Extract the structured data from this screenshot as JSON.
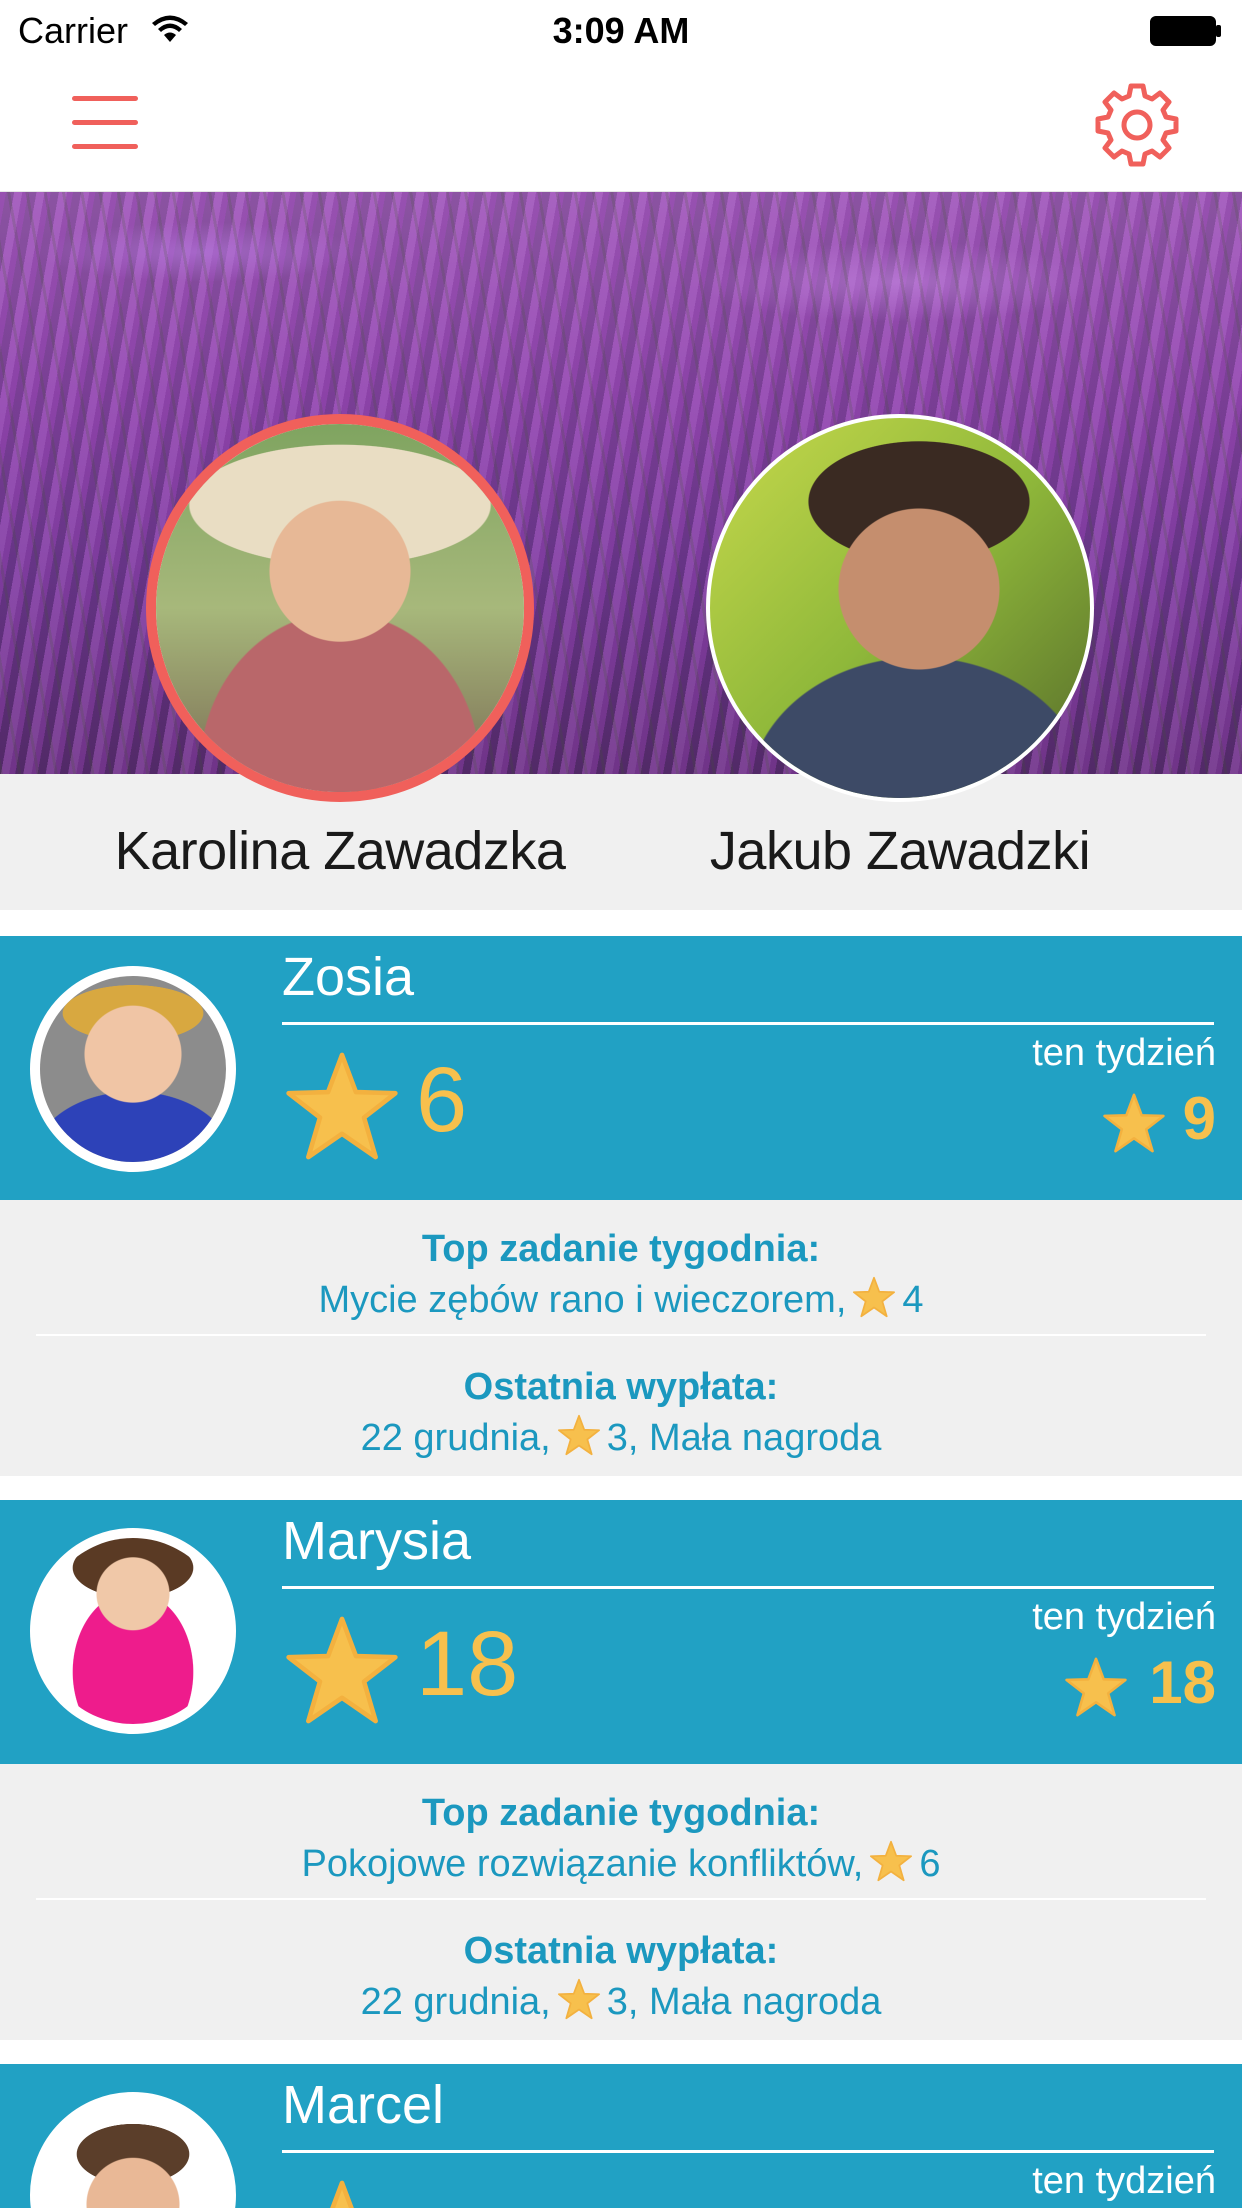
{
  "status_bar": {
    "carrier": "Carrier",
    "time": "3:09 AM"
  },
  "nav": {
    "menu_icon": "hamburger-menu-icon",
    "settings_icon": "gear-icon",
    "accent_color": "#f0605b"
  },
  "parents": [
    {
      "name": "Karolina Zawadzka",
      "selected": true
    },
    {
      "name": "Jakub Zawadzki",
      "selected": false
    }
  ],
  "children": [
    {
      "name": "Zosia",
      "stars": "6",
      "week_label": "ten tydzień",
      "week_stars": "9",
      "top_task_title": "Top zadanie tygodnia:",
      "top_task_text": "Mycie zębów rano i wieczorem,",
      "top_task_stars": "4",
      "payout_title": "Ostatnia wypłata:",
      "payout_date": "22 grudnia,",
      "payout_stars": "3, Mała nagroda"
    },
    {
      "name": "Marysia",
      "stars": "18",
      "week_label": "ten tydzień",
      "week_stars": "18",
      "top_task_title": "Top zadanie tygodnia:",
      "top_task_text": "Pokojowe rozwiązanie konfliktów,",
      "top_task_stars": "6",
      "payout_title": "Ostatnia wypłata:",
      "payout_date": "22 grudnia,",
      "payout_stars": "3, Mała nagroda"
    },
    {
      "name": "Marcel",
      "week_label": "ten tydzień"
    }
  ],
  "colors": {
    "card_blue": "#21a1c4",
    "star_gold": "#f7c04d",
    "info_text": "#1b98bf"
  }
}
